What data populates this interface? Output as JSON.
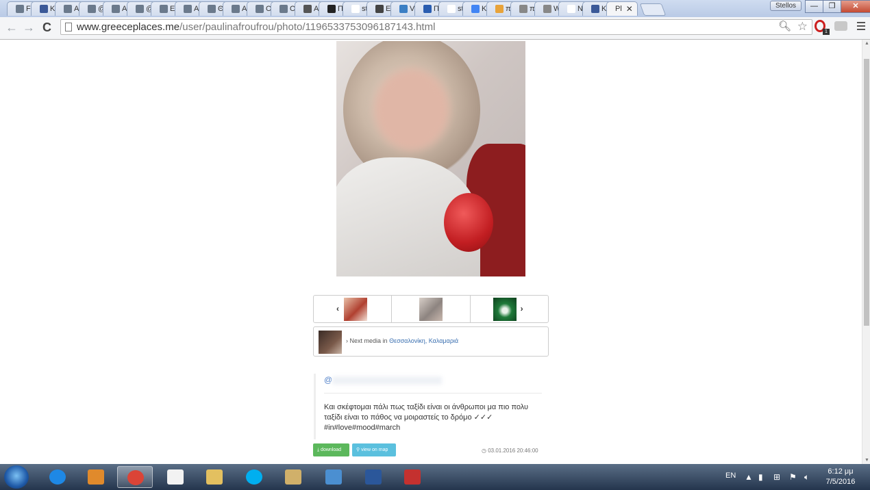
{
  "browser": {
    "tabs": [
      {
        "label": "Fa",
        "fav": "#6b7a8c"
      },
      {
        "label": "Ki",
        "fav": "#3b5998"
      },
      {
        "label": "A",
        "fav": "#6b7a8c"
      },
      {
        "label": "@",
        "fav": "#6b7a8c"
      },
      {
        "label": "A",
        "fav": "#6b7a8c"
      },
      {
        "label": "@",
        "fav": "#6b7a8c"
      },
      {
        "label": "Ev",
        "fav": "#6b7a8c"
      },
      {
        "label": "A",
        "fav": "#6b7a8c"
      },
      {
        "label": "Θ",
        "fav": "#6b7a8c"
      },
      {
        "label": "A",
        "fav": "#6b7a8c"
      },
      {
        "label": "O",
        "fav": "#6b7a8c"
      },
      {
        "label": "O",
        "fav": "#6b7a8c"
      },
      {
        "label": "Ai",
        "fav": "#555555"
      },
      {
        "label": "Π",
        "fav": "#222222"
      },
      {
        "label": "st",
        "fav": "#ffffff"
      },
      {
        "label": "Ei",
        "fav": "#444444"
      },
      {
        "label": "Vi",
        "fav": "#3b7fc4"
      },
      {
        "label": "Π",
        "fav": "#2a5db0"
      },
      {
        "label": "st",
        "fav": "#ffffff"
      },
      {
        "label": "Ki",
        "fav": "#4285f4"
      },
      {
        "label": "πι",
        "fav": "#e8a33a"
      },
      {
        "label": "πι",
        "fav": "#888888"
      },
      {
        "label": "Wπ",
        "fav": "#888888"
      },
      {
        "label": "New",
        "fav": "#ffffff"
      },
      {
        "label": "Ki",
        "fav": "#3b5998"
      }
    ],
    "active_tab": {
      "label": "Pl",
      "close": "✕"
    },
    "profile_name": "Stellos",
    "window": {
      "minimize": "—",
      "restore": "❐",
      "close": "✕"
    },
    "nav": {
      "back": "←",
      "forward": "→",
      "reload": "C"
    },
    "url_host": "www.greeceplaces.me",
    "url_path": "/user/paulinafroufrou/photo/1196533753096187143.html",
    "zoom_icon": "🔍︎",
    "star_icon": "☆"
  },
  "page": {
    "next_media_label": "Next media in",
    "next_media_location": "Θεσσαλονίκη, Καλαμαριά",
    "caption_user_prefix": "@",
    "caption_lines": [
      "Και σκέφτομαι πάλι πως ταξίδι είναι οι άνθρωποι μα πιο πολυ",
      "ταξίδι είναι το πάθος να μοιραστείς το δρόμο ✓✓✓",
      "#in#love#mood#march"
    ],
    "download_label": "download",
    "map_label": "view on map",
    "date": "03.01.2016 20:46:00"
  },
  "taskbar": {
    "language": "EN",
    "time": "6:12 μμ",
    "date": "7/5/2016",
    "apps": [
      {
        "name": "internet-explorer",
        "color": "#1e88e5"
      },
      {
        "name": "media-player",
        "color": "#e08a2c"
      },
      {
        "name": "chrome",
        "color": "#db4437"
      },
      {
        "name": "apps-grid",
        "color": "#f2f2f2"
      },
      {
        "name": "file-explorer",
        "color": "#e3c060"
      },
      {
        "name": "skype",
        "color": "#00aff0"
      },
      {
        "name": "paint",
        "color": "#d0b06a"
      },
      {
        "name": "photo-viewer",
        "color": "#4b8fd1"
      },
      {
        "name": "word",
        "color": "#2b579a"
      },
      {
        "name": "pdf-reader",
        "color": "#c4312f"
      }
    ]
  }
}
